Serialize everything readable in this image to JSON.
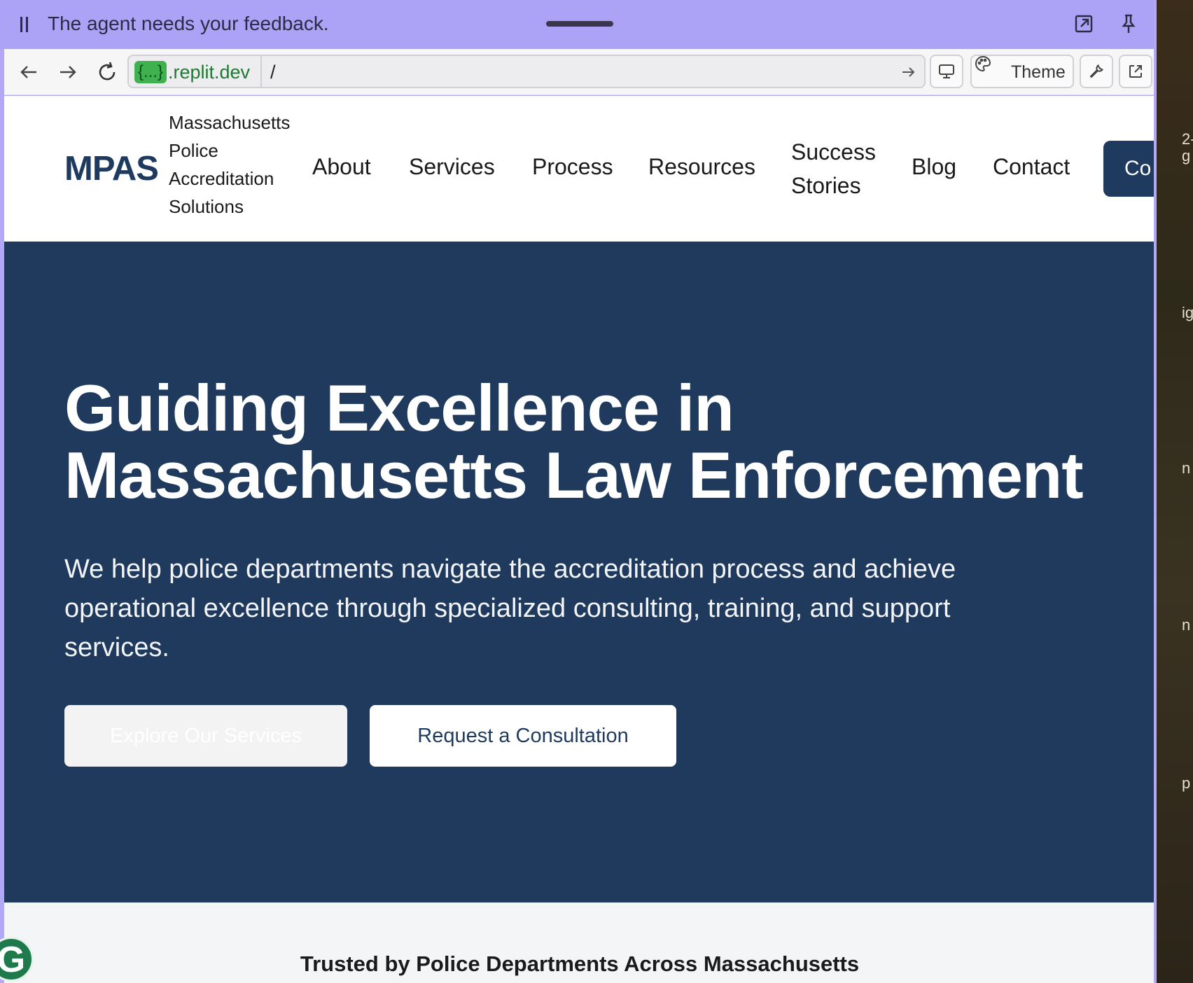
{
  "banner": {
    "message": "The agent needs your feedback."
  },
  "browser": {
    "url_badge": "{...}",
    "url_domain": ".replit.dev",
    "url_path": "/",
    "theme_label": "Theme"
  },
  "site": {
    "logo": "MPAS",
    "org_name_lines": [
      "Massachusetts",
      "Police",
      "Accreditation",
      "Solutions"
    ],
    "nav": [
      {
        "label": "About"
      },
      {
        "label": "Services"
      },
      {
        "label": "Process"
      },
      {
        "label": "Resources"
      },
      {
        "label": "Success Stories"
      },
      {
        "label": "Blog"
      },
      {
        "label": "Contact"
      }
    ],
    "cta_partial": "Co"
  },
  "hero": {
    "title_lines": [
      "Guiding Excellence in",
      "Massachusetts Law Enforcement"
    ],
    "subtitle": "We help police departments navigate the accreditation process and achieve operational excellence through specialized consulting, training, and support services.",
    "primary_button": "Explore Our Services",
    "secondary_button": "Request a Consultation"
  },
  "trusted": {
    "heading": "Trusted by Police Departments Across Massachusetts"
  },
  "floating_badge": "G",
  "side_fragments": [
    "2-",
    "g",
    "ig",
    "n",
    "n",
    "p"
  ],
  "colors": {
    "banner": "#aca2f6",
    "brand_navy": "#1e3a5f",
    "hero_bg": "#1f3a5d",
    "url_green": "#1f7a34"
  }
}
